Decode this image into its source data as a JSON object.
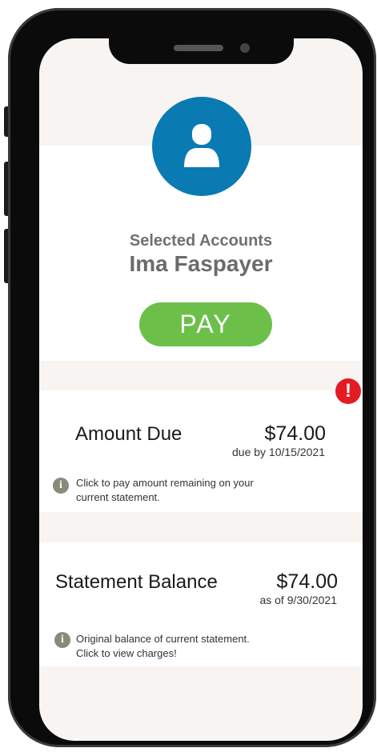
{
  "account": {
    "heading": "Selected Accounts",
    "name": "Ima Faspayer",
    "pay_label": "PAY"
  },
  "alert": {
    "symbol": "!"
  },
  "amount_due": {
    "title": "Amount Due",
    "amount": "$74.00",
    "subtitle": "due by 10/15/2021",
    "info_icon": "i",
    "info_line1": "Click to pay amount remaining on your",
    "info_line2": "current statement."
  },
  "statement_balance": {
    "title": "Statement Balance",
    "amount": "$74.00",
    "subtitle": "as of 9/30/2021",
    "info_icon": "i",
    "info_line1": "Original balance of current statement.",
    "info_line2": "Click to view charges!"
  },
  "colors": {
    "avatar_bg": "#0a7ab3",
    "pay_button": "#6cc04a",
    "alert": "#e41b23",
    "screen_bg": "#f8f4f2"
  },
  "icons": [
    "user-icon",
    "alert-icon",
    "info-icon"
  ]
}
